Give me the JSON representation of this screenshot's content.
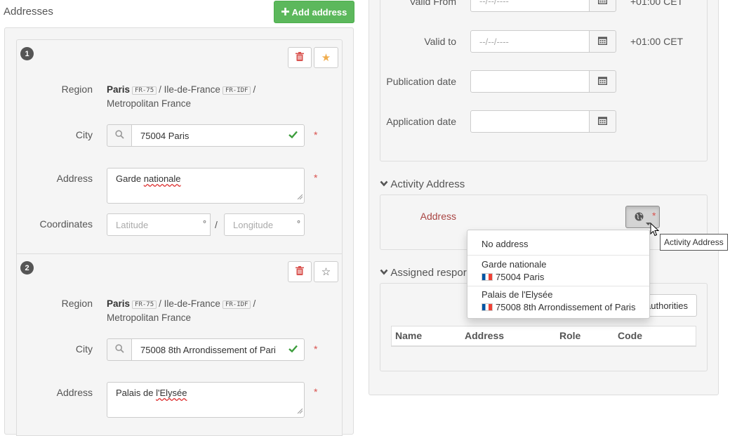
{
  "addresses": {
    "title": "Addresses",
    "add_button_label": "Add address",
    "entries": [
      {
        "number": "1",
        "region_label": "Region",
        "region_name": "Paris",
        "region_code": "FR-75",
        "region_parent": "Ile-de-France",
        "region_parent_code": "FR-IDF",
        "region_country": "Metropolitan France",
        "city_label": "City",
        "city_value": "75004 Paris",
        "address_label": "Address",
        "address_value_a": "Garde ",
        "address_value_b": "nationale",
        "coordinates_label": "Coordinates",
        "latitude_placeholder": "Latitude",
        "longitude_placeholder": "Longitude",
        "degree": "°",
        "separator": "/",
        "required_mark": "*"
      },
      {
        "number": "2",
        "region_label": "Region",
        "region_name": "Paris",
        "region_code": "FR-75",
        "region_parent": "Ile-de-France",
        "region_parent_code": "FR-IDF",
        "region_country": "Metropolitan France",
        "city_label": "City",
        "city_value": "75008 8th Arrondissement of Pari",
        "address_label": "Address",
        "address_value_a": "Palais de ",
        "address_value_b": "l'Elysée",
        "required_mark": "*"
      }
    ]
  },
  "dates": {
    "valid_from_label": "Valid From",
    "valid_from_placeholder": "--/--/----",
    "valid_from_tz": "+01:00 CET",
    "valid_to_label": "Valid to",
    "valid_to_placeholder": "--/--/----",
    "valid_to_tz": "+01:00 CET",
    "publication_label": "Publication date",
    "application_label": "Application date"
  },
  "activity_address": {
    "title": "Activity Address",
    "address_label": "Address",
    "required_mark": "*",
    "tooltip": "Activity Address",
    "dropdown": {
      "none": "No address",
      "options": [
        {
          "name": "Garde nationale",
          "city": "75004 Paris"
        },
        {
          "name": "Palais de l'Elysée",
          "city": "75008 8th Arrondissement of Paris"
        }
      ]
    }
  },
  "assigned": {
    "title": "Assigned respor",
    "authorities_button": "authorities",
    "columns": [
      "Name",
      "Address",
      "Role",
      "Code"
    ]
  },
  "colors": {
    "success": "#5cb85c",
    "required": "#d9534f",
    "star": "#f0ad4e",
    "check": "#3c9d3c"
  }
}
